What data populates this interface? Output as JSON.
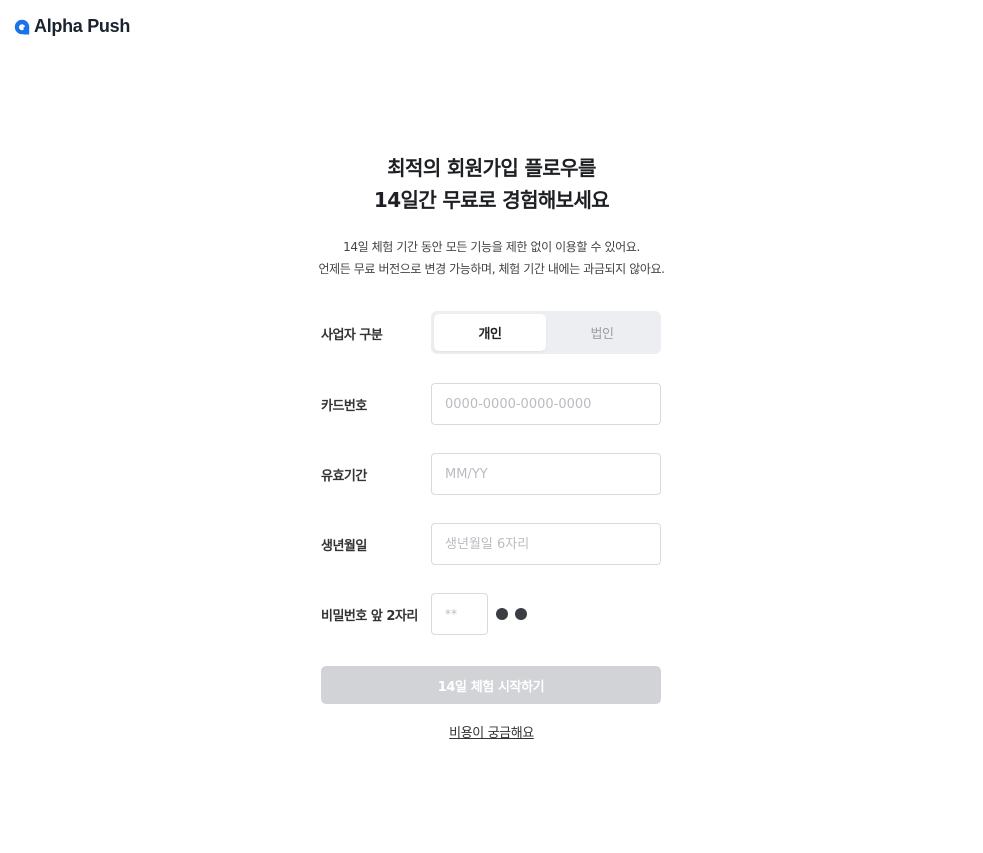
{
  "brand": {
    "name": "Alpha Push",
    "logo_icon": "alphapush-logo-icon",
    "accent": "#1a73e8"
  },
  "hero": {
    "title_line1": "최적의 회원가입 플로우를",
    "title_line2": "14일간 무료로 경험해보세요",
    "desc_line1": "14일 체험 기간 동안 모든 기능을 제한 없이 이용할 수 있어요.",
    "desc_line2": "언제든 무료 버전으로 변경 가능하며, 체험 기간 내에는 과금되지 않아요."
  },
  "form": {
    "business_type": {
      "label": "사업자 구분",
      "options": [
        "개인",
        "법인"
      ],
      "selected": "개인"
    },
    "card_number": {
      "label": "카드번호",
      "value": "",
      "placeholder": "0000-0000-0000-0000"
    },
    "expiry": {
      "label": "유효기간",
      "value": "",
      "placeholder": "MM/YY"
    },
    "birth": {
      "label": "생년월일",
      "value": "",
      "placeholder": "생년월일 6자리"
    },
    "password": {
      "label": "비밀번호 앞 2자리",
      "value": "",
      "placeholder": "**"
    },
    "submit_label": "14일 체험 시작하기",
    "cost_link": "비용이 궁금해요"
  },
  "colors": {
    "submit_disabled": "#d1d3d6",
    "segment_bg": "#eceef1",
    "input_border": "#d7dadf"
  }
}
